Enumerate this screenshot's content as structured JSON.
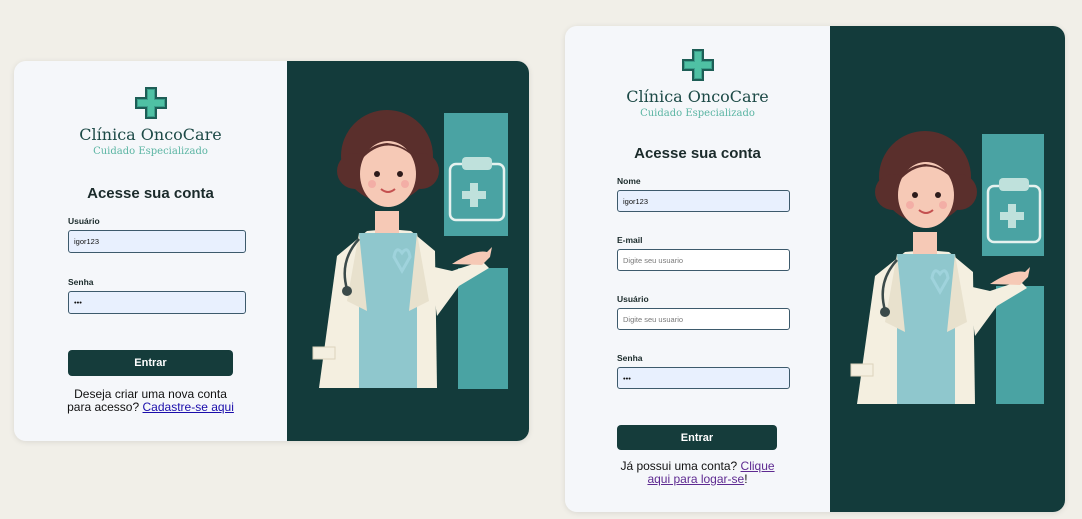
{
  "brand": {
    "name": "Clínica OncoCare",
    "tagline": "Cuidado Especializado"
  },
  "login": {
    "heading": "Acesse sua conta",
    "user_label": "Usuário",
    "user_value": "igor123",
    "password_label": "Senha",
    "password_value": "•••",
    "submit_label": "Entrar",
    "footer_text_line1": "Deseja criar uma nova conta",
    "footer_text_line2": "para acesso?",
    "footer_link": "Cadastre-se aqui"
  },
  "register": {
    "heading": "Acesse sua conta",
    "name_label": "Nome",
    "name_value": "igor123",
    "email_label": "E-mail",
    "email_placeholder": "Digite seu usuario",
    "user_label": "Usuário",
    "user_placeholder": "Digite seu usuario",
    "password_label": "Senha",
    "password_value": "•••",
    "submit_label": "Entrar",
    "footer_text": "Já possui uma conta?",
    "footer_link_line1": "Clique",
    "footer_link_line2": "aqui para logar-se",
    "footer_link_tail": "!"
  },
  "colors": {
    "panel_dark": "#133b3b",
    "teal": "#4aa3a3",
    "button": "#153c3b",
    "input_fill": "#e8f0fe"
  },
  "icons": [
    "medical-cross-icon",
    "clipboard-cross-icon",
    "stethoscope-icon",
    "awareness-ribbon-icon"
  ]
}
